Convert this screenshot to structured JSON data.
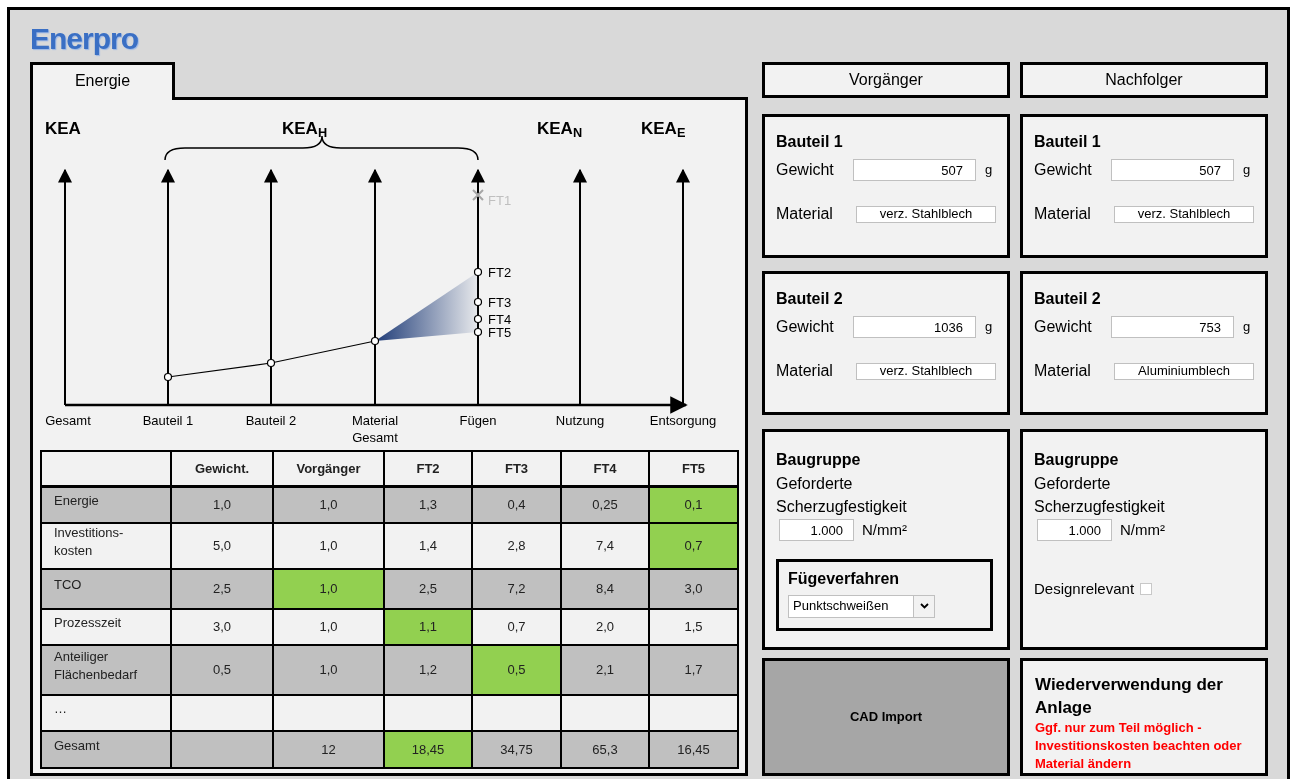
{
  "logo": "Enerpro",
  "tabs": [
    {
      "label": "Energie",
      "selected": true
    }
  ],
  "diagram": {
    "headings": [
      "KEA",
      "KEA$_{H}$",
      "KEA$_{N}$",
      "KEA$_{E}$"
    ],
    "axes": [
      "Gesamt",
      "Bauteil 1",
      "Bauteil 2",
      "Material\nGesamt",
      "Fügen",
      "Nutzung",
      "Entsorgung"
    ],
    "markers": [
      {
        "label": "FT1",
        "excluded": true
      },
      {
        "label": "FT2",
        "excluded": false
      },
      {
        "label": "FT3",
        "excluded": false
      },
      {
        "label": "FT4",
        "excluded": false
      },
      {
        "label": "FT5",
        "excluded": false
      }
    ]
  },
  "table": {
    "columns": [
      "Gewicht.",
      "Vorgänger",
      "FT2",
      "FT3",
      "FT4",
      "FT5"
    ],
    "rows": [
      {
        "label": "Energie",
        "shaded": true,
        "cells": [
          {
            "text": "1,0",
            "highlight": false
          },
          {
            "text": "1,0",
            "highlight": false
          },
          {
            "text": "1,3",
            "highlight": false
          },
          {
            "text": "0,4",
            "highlight": false
          },
          {
            "text": "0,25",
            "highlight": false
          },
          {
            "text": "0,1",
            "highlight": true
          }
        ]
      },
      {
        "label": "Investitions-\nkosten",
        "shaded": false,
        "cells": [
          {
            "text": "5,0",
            "highlight": false
          },
          {
            "text": "1,0",
            "highlight": false
          },
          {
            "text": "1,4",
            "highlight": false
          },
          {
            "text": "2,8",
            "highlight": false
          },
          {
            "text": "7,4",
            "highlight": false
          },
          {
            "text": "0,7",
            "highlight": true
          }
        ]
      },
      {
        "label": "TCO",
        "shaded": true,
        "cells": [
          {
            "text": "2,5",
            "highlight": false
          },
          {
            "text": "1,0",
            "highlight": true
          },
          {
            "text": "2,5",
            "highlight": false
          },
          {
            "text": "7,2",
            "highlight": false
          },
          {
            "text": "8,4",
            "highlight": false
          },
          {
            "text": "3,0",
            "highlight": false
          }
        ]
      },
      {
        "label": "Prozesszeit",
        "shaded": false,
        "cells": [
          {
            "text": "3,0",
            "highlight": false
          },
          {
            "text": "1,0",
            "highlight": false
          },
          {
            "text": "1,1",
            "highlight": true
          },
          {
            "text": "0,7",
            "highlight": false
          },
          {
            "text": "2,0",
            "highlight": false
          },
          {
            "text": "1,5",
            "highlight": false
          }
        ]
      },
      {
        "label": "Anteiliger\nFlächenbedarf",
        "shaded": true,
        "cells": [
          {
            "text": "0,5",
            "highlight": false
          },
          {
            "text": "1,0",
            "highlight": false
          },
          {
            "text": "1,2",
            "highlight": false
          },
          {
            "text": "0,5",
            "highlight": true
          },
          {
            "text": "2,1",
            "highlight": false
          },
          {
            "text": "1,7",
            "highlight": false
          }
        ]
      },
      {
        "label": "…",
        "shaded": false,
        "cells": []
      },
      {
        "label": "Gesamt",
        "shaded": true,
        "cells": [
          null,
          {
            "text": "12",
            "highlight": false
          },
          {
            "text": "18,45",
            "highlight": true
          },
          {
            "text": "34,75",
            "highlight": false
          },
          {
            "text": "65,3",
            "highlight": false
          },
          {
            "text": "16,45",
            "highlight": false
          }
        ]
      }
    ]
  },
  "sides": [
    {
      "header": "Vorgänger",
      "parts": [
        {
          "title": "Bauteil 1",
          "weight_label": "Gewicht",
          "weight": "507",
          "unit": "g",
          "material_label": "Material",
          "material": "verz. Stahlblech"
        },
        {
          "title": "Bauteil 2",
          "weight_label": "Gewicht",
          "weight": "1036",
          "unit": "g",
          "material_label": "Material",
          "material": "verz. Stahlblech"
        }
      ],
      "assembly": {
        "title": "Baugruppe",
        "label": "Geforderte Scherzugfestigkeit",
        "value": "1.000",
        "unit": "N/mm²",
        "extra": {
          "kind": "dropdown",
          "title": "Fügeverfahren",
          "value": "Punktschweißen"
        }
      },
      "bottom": {
        "kind": "button",
        "label": "CAD Import"
      }
    },
    {
      "header": "Nachfolger",
      "parts": [
        {
          "title": "Bauteil 1",
          "weight_label": "Gewicht",
          "weight": "507",
          "unit": "g",
          "material_label": "Material",
          "material": "verz. Stahlblech"
        },
        {
          "title": "Bauteil 2",
          "weight_label": "Gewicht",
          "weight": "753",
          "unit": "g",
          "material_label": "Material",
          "material": "Aluminiumblech"
        }
      ],
      "assembly": {
        "title": "Baugruppe",
        "label": "Geforderte Scherzugfestigkeit",
        "value": "1.000",
        "unit": "N/mm²",
        "extra": {
          "kind": "checkbox",
          "label": "Designrelevant",
          "checked": false
        }
      },
      "bottom": {
        "kind": "note",
        "title": "Wiederverwendung der Anlage",
        "text": "Ggf. nur zum Teil möglich - Investitionskosten beachten oder Material ändern"
      }
    }
  ]
}
